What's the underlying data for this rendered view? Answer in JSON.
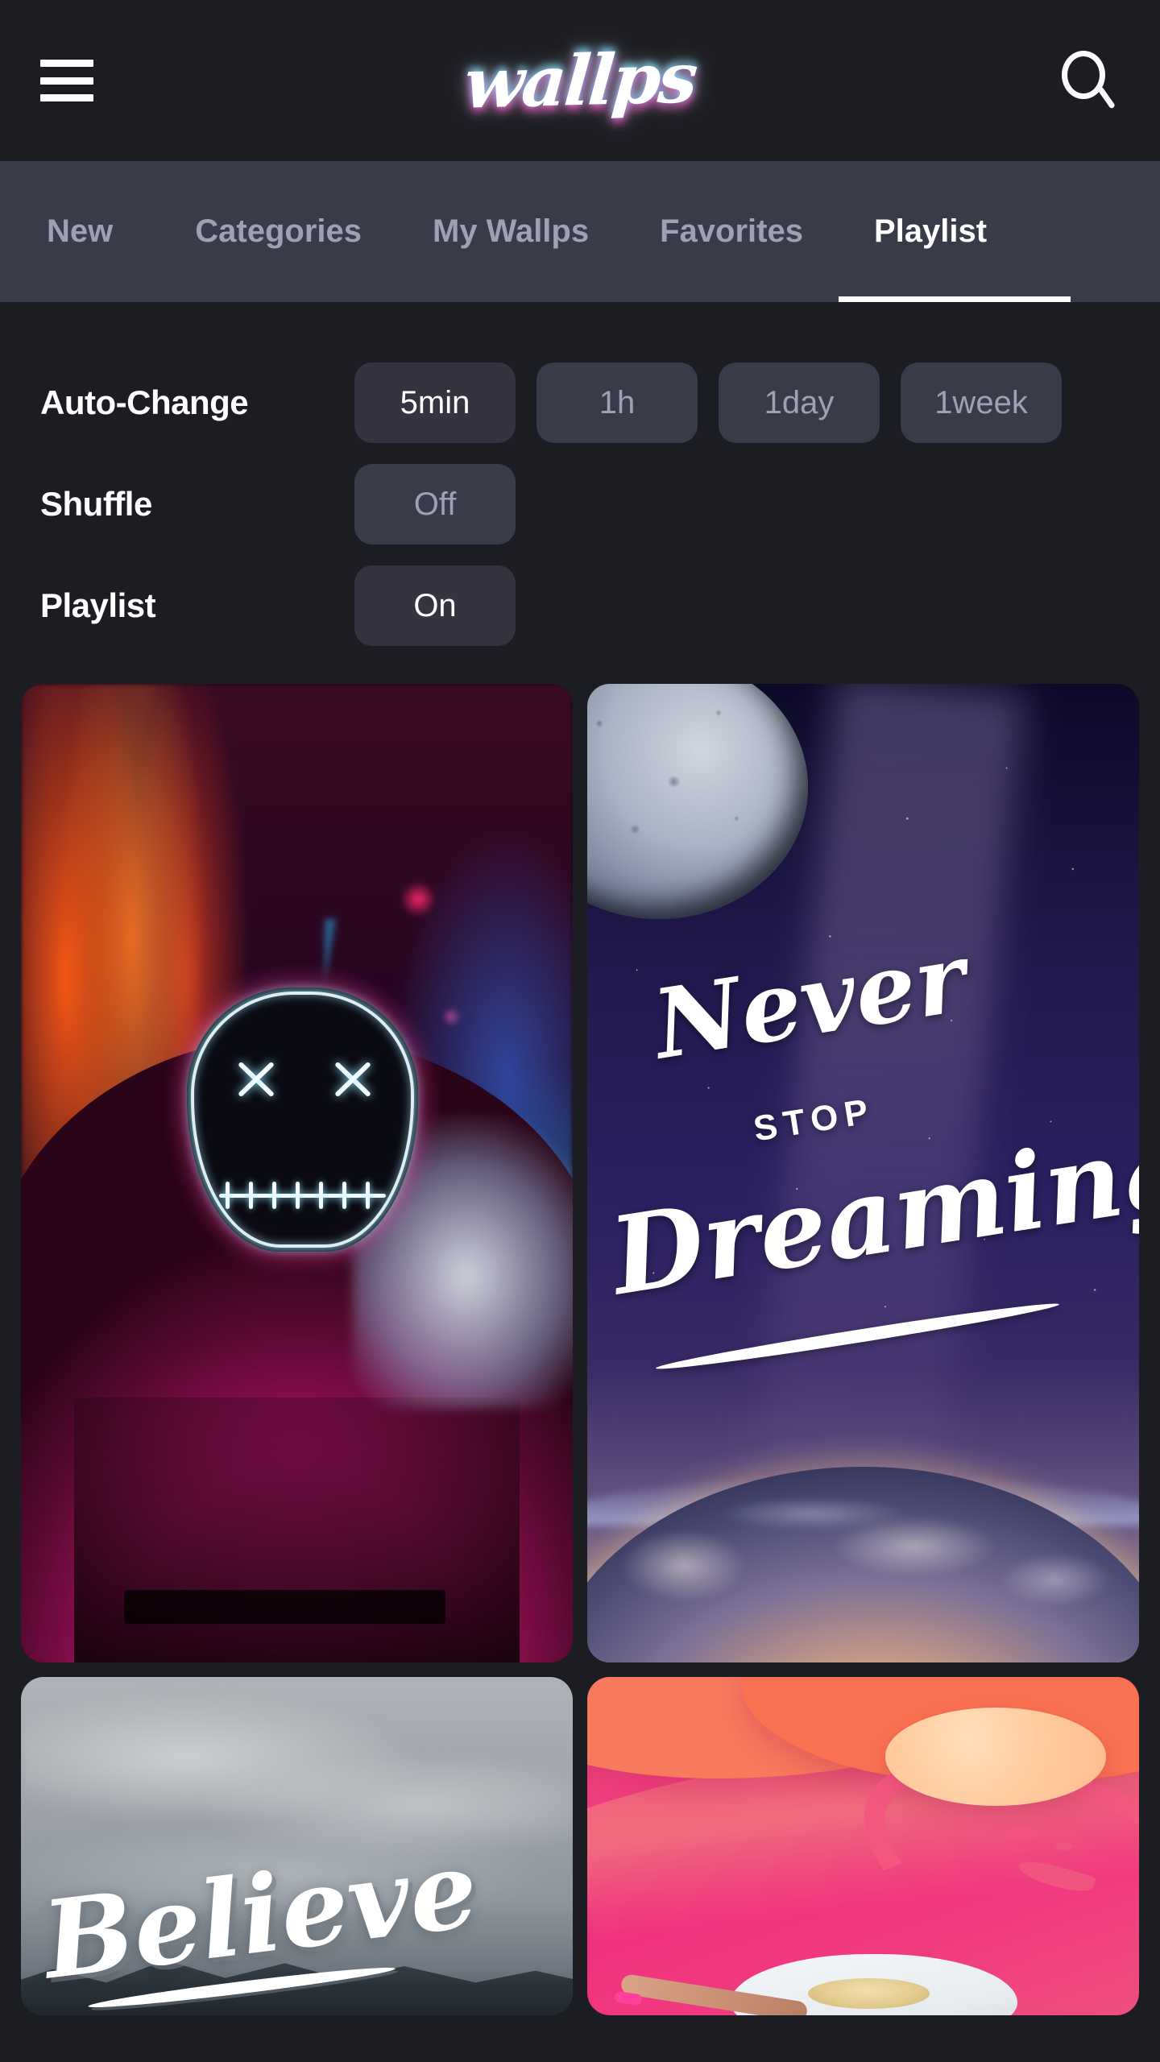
{
  "app": {
    "logo_text": "wallps",
    "background_color": "#1b1d23",
    "surface_color": "#3a3b49",
    "accent_text_color": "#ffffff",
    "muted_text_color": "#9ea0b4"
  },
  "header": {
    "menu_icon": "hamburger-menu-icon",
    "search_icon": "search-icon"
  },
  "tabs": [
    {
      "label": "New",
      "active": false
    },
    {
      "label": "Categories",
      "active": false
    },
    {
      "label": "My Wallps",
      "active": false
    },
    {
      "label": "Favorites",
      "active": false
    },
    {
      "label": "Playlist",
      "active": true
    }
  ],
  "settings": [
    {
      "label": "Auto-Change",
      "options": [
        {
          "value": "5min",
          "selected": true
        },
        {
          "value": "1h",
          "selected": false
        },
        {
          "value": "1day",
          "selected": false
        },
        {
          "value": "1week",
          "selected": false
        }
      ]
    },
    {
      "label": "Shuffle",
      "options": [
        {
          "value": "Off",
          "selected": false
        }
      ]
    },
    {
      "label": "Playlist",
      "options": [
        {
          "value": "On",
          "selected": true
        }
      ]
    }
  ],
  "wallpapers": [
    {
      "name": "neon-mask-wallpaper",
      "description": "Hooded figure wearing glowing neon LED mask with X eyes and stitched mouth, magenta hoodie, neon city street",
      "overlay_text": ""
    },
    {
      "name": "never-stop-dreaming-wallpaper",
      "description": "Starfield with moon and earth horizon",
      "line1": "Never",
      "line2": "STOP",
      "line3": "Dreaming"
    },
    {
      "name": "believe-wallpaper",
      "description": "Misty gray mountain ridge with white brush script lettering",
      "overlay_text": "Believe"
    },
    {
      "name": "abstract-pink-wallpaper",
      "description": "Abstract layered coral and pink paper-cut shapes with peach sun circle and person in straw hat",
      "overlay_text": ""
    }
  ]
}
